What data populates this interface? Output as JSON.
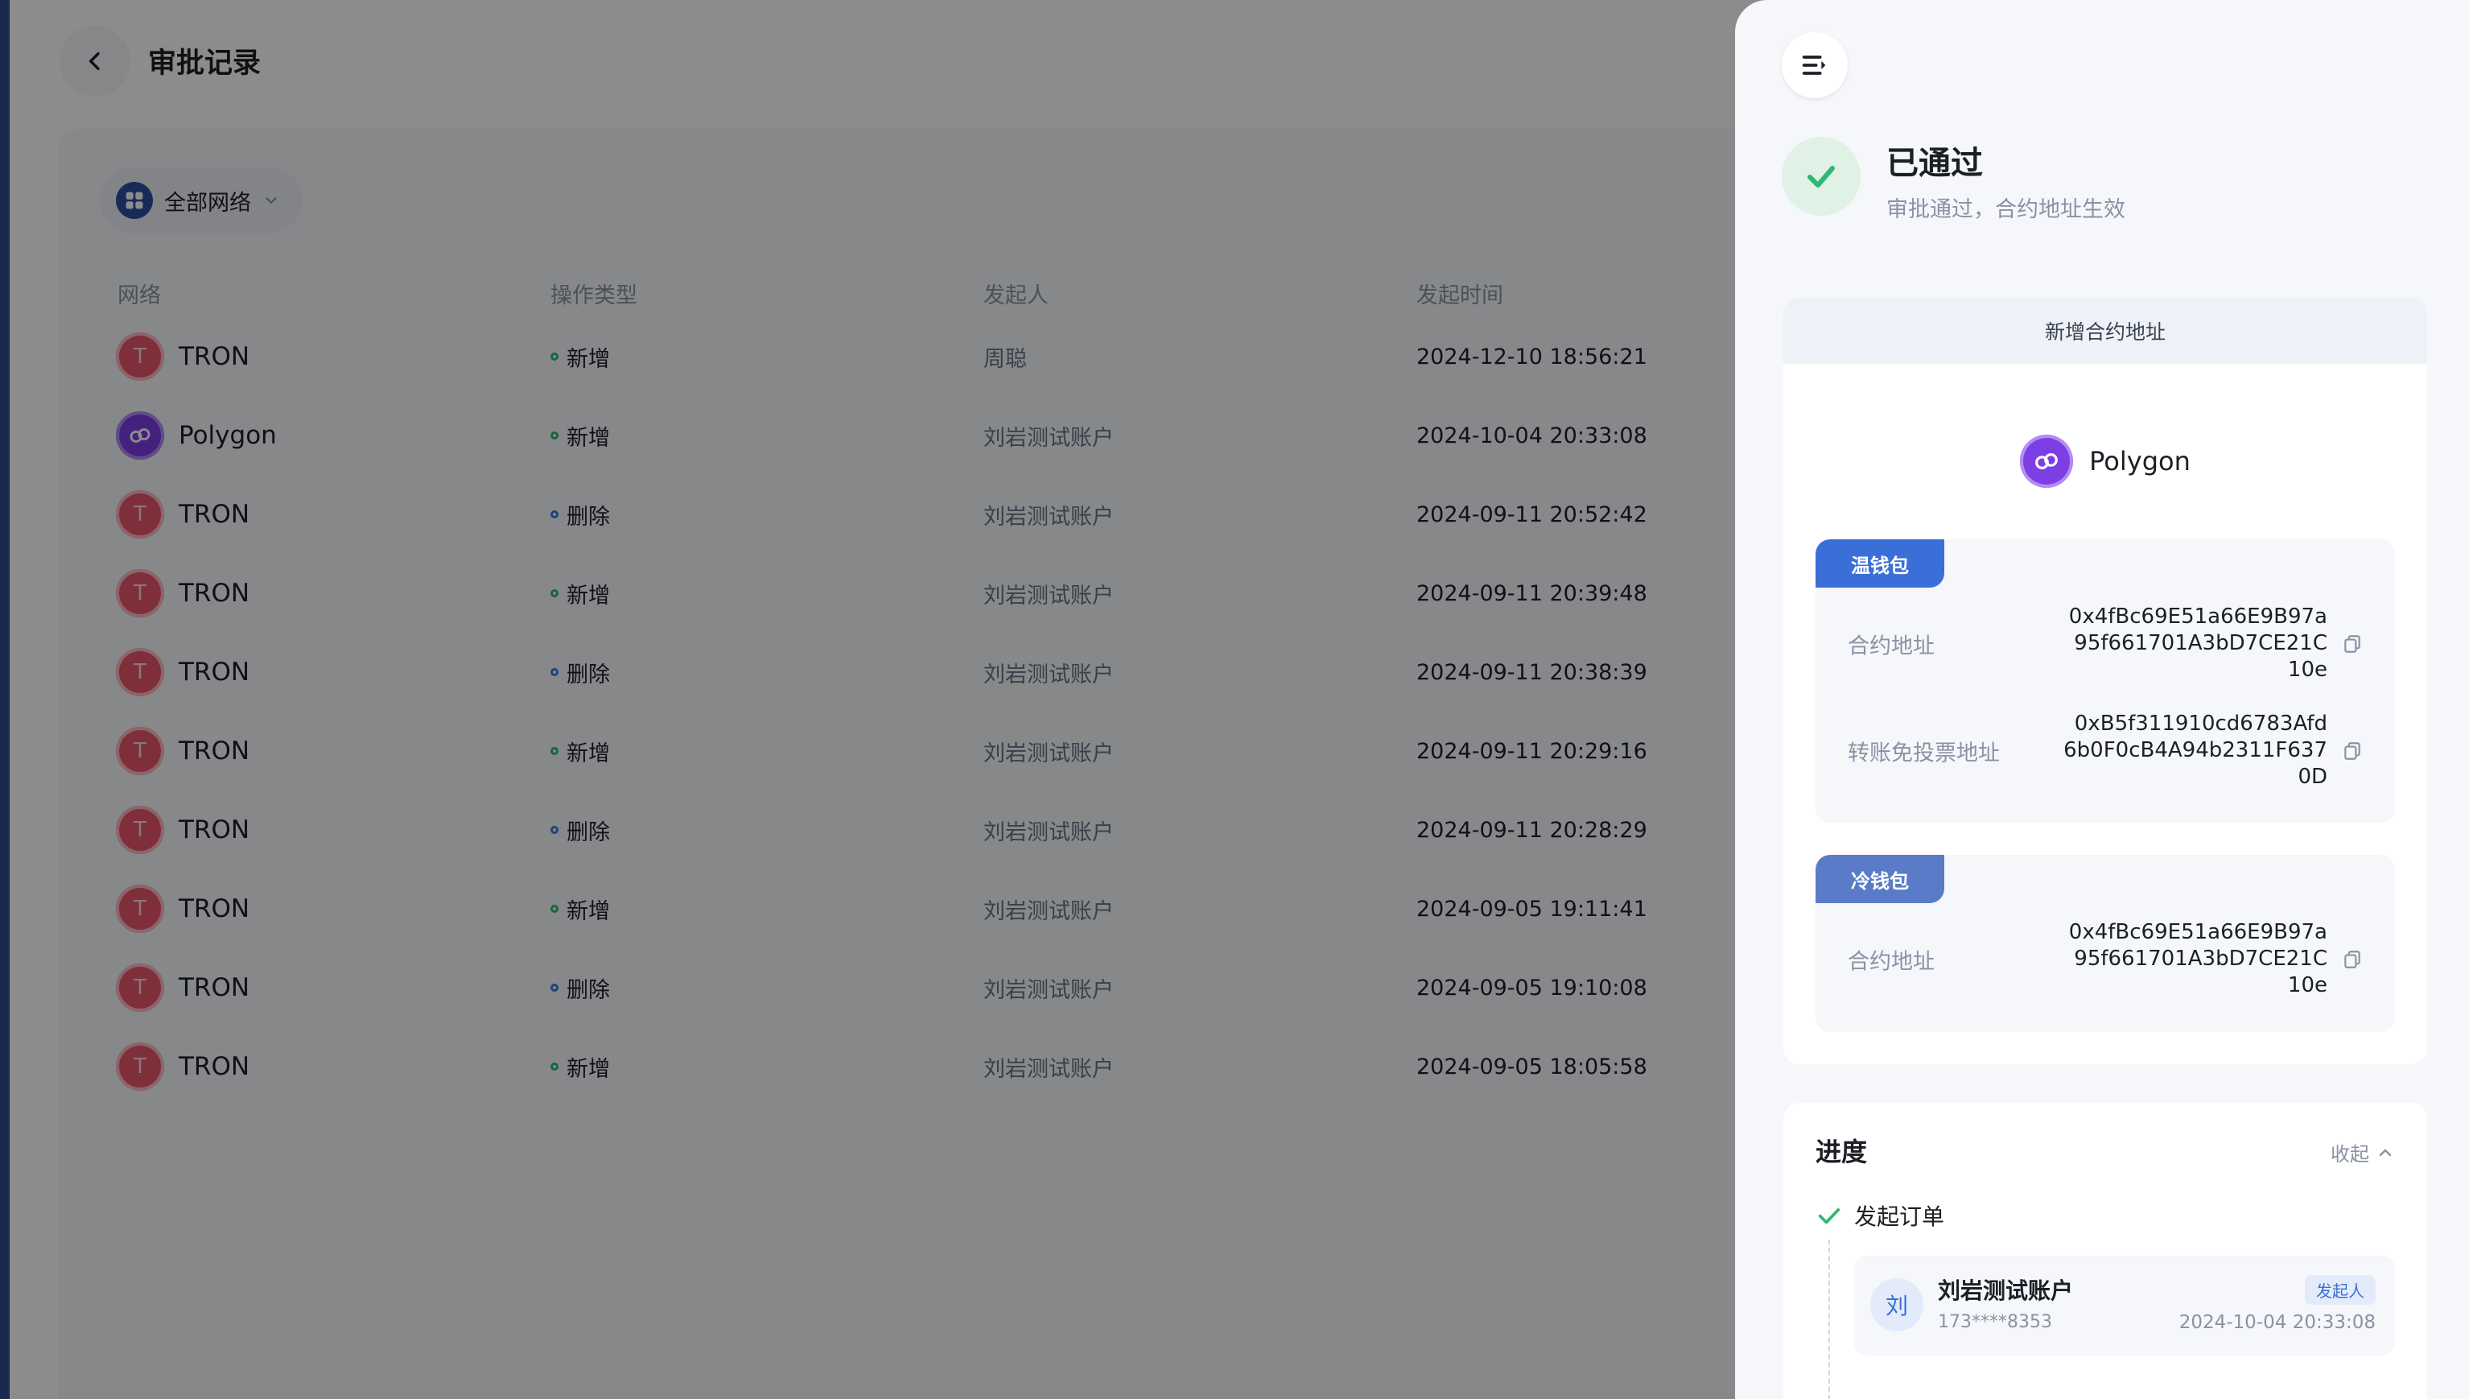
{
  "page": {
    "title": "审批记录",
    "filter_label": "全部网络"
  },
  "table": {
    "headers": {
      "network": "网络",
      "operation": "操作类型",
      "initiator": "发起人",
      "time": "发起时间"
    },
    "rows": [
      {
        "network": "TRON",
        "chain": "tron",
        "operation": "新增",
        "op_type": "add",
        "initiator": "周聪",
        "time": "2024-12-10 18:56:21"
      },
      {
        "network": "Polygon",
        "chain": "polygon",
        "operation": "新增",
        "op_type": "add",
        "initiator": "刘岩测试账户",
        "time": "2024-10-04 20:33:08"
      },
      {
        "network": "TRON",
        "chain": "tron",
        "operation": "删除",
        "op_type": "delete",
        "initiator": "刘岩测试账户",
        "time": "2024-09-11 20:52:42"
      },
      {
        "network": "TRON",
        "chain": "tron",
        "operation": "新增",
        "op_type": "add",
        "initiator": "刘岩测试账户",
        "time": "2024-09-11 20:39:48"
      },
      {
        "network": "TRON",
        "chain": "tron",
        "operation": "删除",
        "op_type": "delete",
        "initiator": "刘岩测试账户",
        "time": "2024-09-11 20:38:39"
      },
      {
        "network": "TRON",
        "chain": "tron",
        "operation": "新增",
        "op_type": "add",
        "initiator": "刘岩测试账户",
        "time": "2024-09-11 20:29:16"
      },
      {
        "network": "TRON",
        "chain": "tron",
        "operation": "删除",
        "op_type": "delete",
        "initiator": "刘岩测试账户",
        "time": "2024-09-11 20:28:29"
      },
      {
        "network": "TRON",
        "chain": "tron",
        "operation": "新增",
        "op_type": "add",
        "initiator": "刘岩测试账户",
        "time": "2024-09-05 19:11:41"
      },
      {
        "network": "TRON",
        "chain": "tron",
        "operation": "删除",
        "op_type": "delete",
        "initiator": "刘岩测试账户",
        "time": "2024-09-05 19:10:08"
      },
      {
        "network": "TRON",
        "chain": "tron",
        "operation": "新增",
        "op_type": "add",
        "initiator": "刘岩测试账户",
        "time": "2024-09-05 18:05:58"
      }
    ]
  },
  "drawer": {
    "status_title": "已通过",
    "status_desc": "审批通过，合约地址生效",
    "detail_title": "新增合约地址",
    "chain_name": "Polygon",
    "hot_wallet": {
      "tag": "温钱包",
      "contract_label": "合约地址",
      "contract_address": "0x4fBc69E51a66E9B97a95f661701A3bD7CE21C10e",
      "transfer_label": "转账免投票地址",
      "transfer_address": "0xB5f311910cd6783Afd6b0F0cB4A94b2311F6370D"
    },
    "cold_wallet": {
      "tag": "冷钱包",
      "contract_label": "合约地址",
      "contract_address": "0x4fBc69E51a66E9B97a95f661701A3bD7CE21C10e"
    },
    "progress": {
      "title": "进度",
      "collapse_label": "收起",
      "step_label": "发起订单",
      "approver": {
        "avatar_char": "刘",
        "name": "刘岩测试账户",
        "phone": "173****8353",
        "role": "发起人",
        "time": "2024-10-04 20:33:08"
      }
    }
  },
  "colors": {
    "sidebar_accent": "#2f4e92",
    "success": "#2eb872",
    "primary": "#3a6fd8",
    "tron": "#e5566a",
    "polygon": "#7b3fe4"
  }
}
